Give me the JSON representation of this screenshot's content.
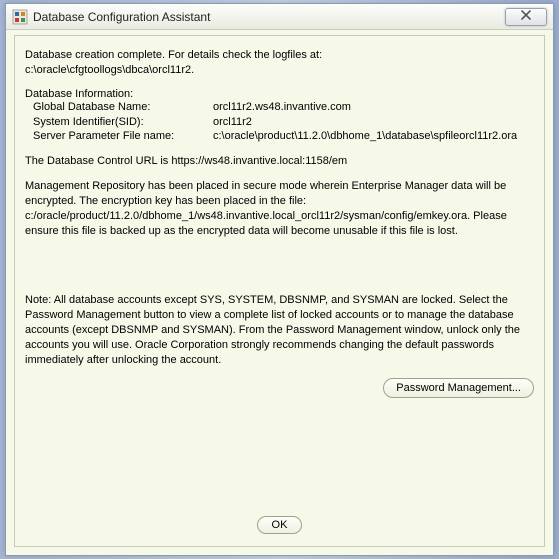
{
  "window": {
    "title": "Database Configuration Assistant"
  },
  "intro": {
    "line1": "Database creation complete. For details check the logfiles at:",
    "line2": " c:\\oracle\\cfgtoollogs\\dbca\\orcl11r2."
  },
  "dbinfo": {
    "header": "Database Information:",
    "rows": [
      {
        "label": "Global Database Name:",
        "value": "orcl11r2.ws48.invantive.com"
      },
      {
        "label": "System Identifier(SID):",
        "value": "orcl11r2"
      },
      {
        "label": "Server Parameter File name:",
        "value": "c:\\oracle\\product\\11.2.0\\dbhome_1\\database\\spfileorcl11r2.ora"
      }
    ]
  },
  "control_url": "The Database Control URL is https://ws48.invantive.local:1158/em",
  "repo": "Management Repository has been placed in secure mode wherein Enterprise Manager data will be encrypted.  The encryption key has been placed in the file: c:/oracle/product/11.2.0/dbhome_1/ws48.invantive.local_orcl11r2/sysman/config/emkey.ora.   Please ensure this file is backed up as the encrypted data will become unusable if this file is lost.",
  "note": "Note: All database accounts except SYS, SYSTEM, DBSNMP, and SYSMAN are locked. Select the Password Management button to view a complete list of locked accounts or to manage the database accounts (except DBSNMP and SYSMAN). From the Password Management window, unlock only the accounts you will use. Oracle Corporation strongly recommends changing the default passwords immediately after unlocking the account.",
  "buttons": {
    "password_mgmt": "Password Management...",
    "ok": "OK"
  }
}
